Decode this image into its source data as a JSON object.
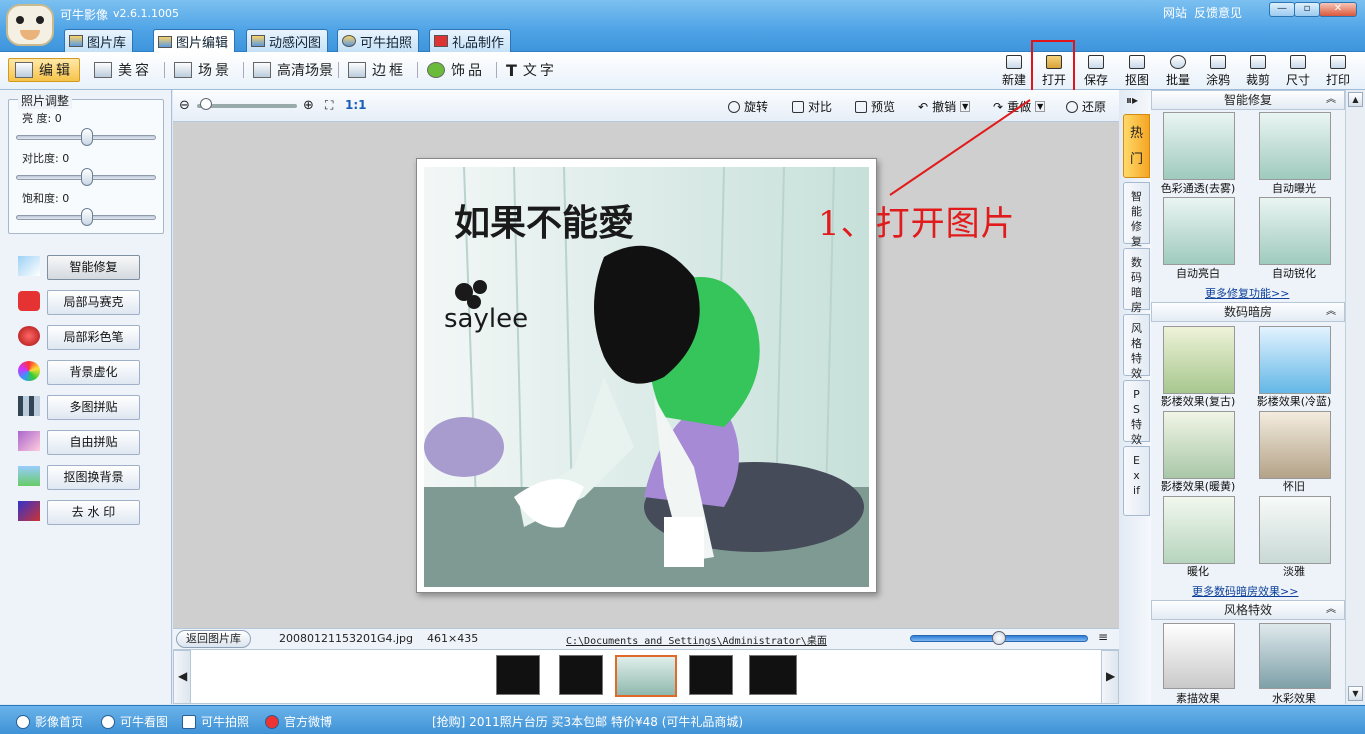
{
  "app": {
    "title": "可牛影像",
    "version": "v2.6.1.1005",
    "link_site": "网站",
    "link_feedback": "反馈意见"
  },
  "tabs": [
    {
      "label": "图片库"
    },
    {
      "label": "图片编辑"
    },
    {
      "label": "动感闪图"
    },
    {
      "label": "可牛拍照"
    },
    {
      "label": "礼品制作"
    }
  ],
  "toolbar": {
    "left": [
      {
        "label": "编辑"
      },
      {
        "label": "美容"
      },
      {
        "label": "场景"
      },
      {
        "label": "高清场景"
      },
      {
        "label": "边框"
      },
      {
        "label": "饰品"
      },
      {
        "label": "文字"
      }
    ],
    "right": [
      {
        "label": "新建"
      },
      {
        "label": "打开"
      },
      {
        "label": "保存"
      },
      {
        "label": "抠图"
      },
      {
        "label": "批量"
      },
      {
        "label": "涂鸦"
      },
      {
        "label": "裁剪"
      },
      {
        "label": "尺寸"
      },
      {
        "label": "打印"
      }
    ]
  },
  "adjust": {
    "title": "照片调整",
    "brightness": "亮  度: 0",
    "contrast": "对比度: 0",
    "saturation": "饱和度: 0"
  },
  "left_buttons": [
    {
      "label": "智能修复"
    },
    {
      "label": "局部马赛克"
    },
    {
      "label": "局部彩色笔"
    },
    {
      "label": "背景虚化"
    },
    {
      "label": "多图拼贴"
    },
    {
      "label": "自由拼贴"
    },
    {
      "label": "抠图换背景"
    },
    {
      "label": "去 水 印"
    }
  ],
  "viewbar": {
    "ratio": "1:1",
    "rotate": "旋转",
    "compare": "对比",
    "preview": "预览",
    "undo": "撤销",
    "redo": "重做",
    "restore": "还原"
  },
  "annotation": "1、打开图片",
  "photo": {
    "title": "如果不能愛",
    "signature": "saylee"
  },
  "status": {
    "back": "返回图片库",
    "filename": "20080121153201G4.jpg",
    "dimensions": "461×435",
    "path": "C:\\Documents and Settings\\Administrator\\桌面"
  },
  "vtabs": [
    {
      "label": "热门"
    },
    {
      "label": "智能修复"
    },
    {
      "label": "数码暗房"
    },
    {
      "label": "风格特效"
    },
    {
      "label": "PS特效"
    },
    {
      "label": "Exif"
    }
  ],
  "sections": {
    "repair": {
      "title": "智能修复",
      "items": [
        "色彩通透(去雾)",
        "自动曝光",
        "自动亮白",
        "自动锐化"
      ],
      "more": "更多修复功能>>"
    },
    "darkroom": {
      "title": "数码暗房",
      "items": [
        "影楼效果(复古)",
        "影楼效果(冷蓝)",
        "影楼效果(暖黄)",
        "怀旧",
        "暖化",
        "淡雅"
      ],
      "more": "更多数码暗房效果>>"
    },
    "style": {
      "title": "风格特效",
      "items": [
        "素描效果",
        "水彩效果"
      ]
    }
  },
  "bottom": {
    "links": [
      {
        "label": "影像首页"
      },
      {
        "label": "可牛看图"
      },
      {
        "label": "可牛拍照"
      },
      {
        "label": "官方微博"
      }
    ],
    "promo": "[抢购] 2011照片台历 买3本包邮 特价¥48 (可牛礼品商城)"
  },
  "colors": {
    "accent": "#3f95dc",
    "annotation_red": "#e11b1b",
    "active_tool": "#f6c34a"
  }
}
